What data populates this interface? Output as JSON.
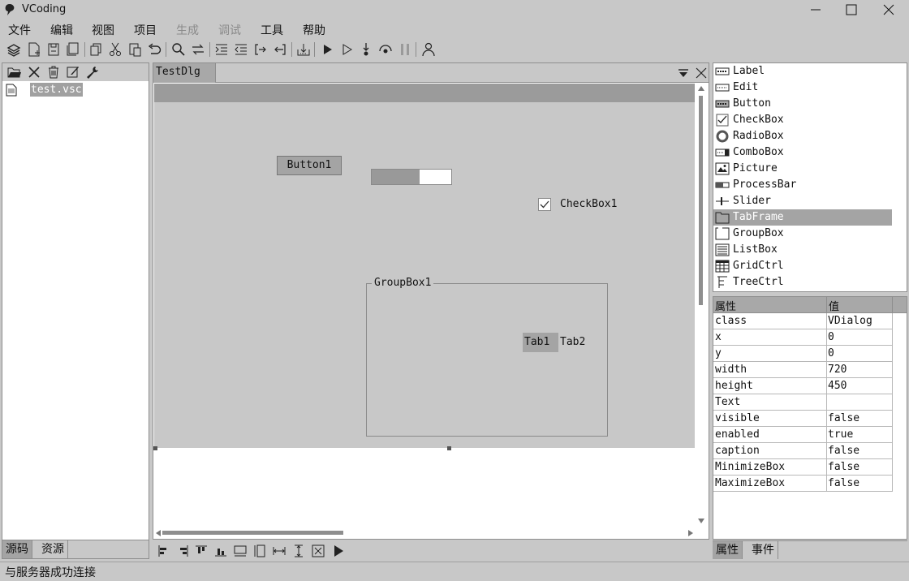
{
  "window": {
    "title": "VCoding",
    "minimize_icon": "minimize-icon",
    "maximize_icon": "maximize-icon",
    "close_icon": "close-icon"
  },
  "menu": [
    "文件",
    "编辑",
    "视图",
    "项目",
    "生成",
    "调试",
    "工具",
    "帮助"
  ],
  "menu_disabled": [
    "生成",
    "调试"
  ],
  "toolbar_icons": [
    "layers-icon",
    "new-file-icon",
    "save-icon",
    "save-all-icon",
    "copy-icon",
    "cut-icon",
    "paste-icon",
    "undo-icon",
    "find-icon",
    "replace-icon",
    "indent-icon",
    "outdent-icon",
    "step-in-icon",
    "step-out-icon",
    "build-icon",
    "run-icon",
    "run-outline-icon",
    "step-icon",
    "watch-icon",
    "pause-icon",
    "user-icon"
  ],
  "left_panel": {
    "toolbar_icons": [
      "open-folder-icon",
      "close-icon",
      "delete-icon",
      "edit-icon",
      "wrench-icon"
    ],
    "files": [
      {
        "name": "test.vsc",
        "icon": "file-icon"
      }
    ],
    "tabs": [
      "源码",
      "资源"
    ],
    "active_tab": "源码"
  },
  "document": {
    "tab_title": "TestDlg",
    "tab_menu_icon": "dropdown-icon",
    "tab_close_icon": "close-icon",
    "controls": {
      "button1": "Button1",
      "progress_value": 0.6,
      "checkbox1": "CheckBox1",
      "checkbox1_checked": true,
      "groupbox1": "GroupBox1",
      "tabs": [
        "Tab1",
        "Tab2"
      ]
    }
  },
  "align_toolbar_icons": [
    "align-left-icon",
    "align-right-icon",
    "align-top-icon",
    "align-bottom-icon",
    "same-width-icon",
    "same-height-icon",
    "center-horizontal-icon",
    "center-vertical-icon",
    "center-icon",
    "preview-run-icon"
  ],
  "toolbox": {
    "items": [
      {
        "label": "Label",
        "icon": "label-control-icon"
      },
      {
        "label": "Edit",
        "icon": "edit-control-icon"
      },
      {
        "label": "Button",
        "icon": "button-control-icon"
      },
      {
        "label": "CheckBox",
        "icon": "checkbox-control-icon"
      },
      {
        "label": "RadioBox",
        "icon": "radiobox-control-icon"
      },
      {
        "label": "ComboBox",
        "icon": "combobox-control-icon"
      },
      {
        "label": "Picture",
        "icon": "picture-control-icon"
      },
      {
        "label": "ProcessBar",
        "icon": "processbar-control-icon"
      },
      {
        "label": "Slider",
        "icon": "slider-control-icon"
      },
      {
        "label": "TabFrame",
        "icon": "tabframe-control-icon"
      },
      {
        "label": "GroupBox",
        "icon": "groupbox-control-icon"
      },
      {
        "label": "ListBox",
        "icon": "listbox-control-icon"
      },
      {
        "label": "GridCtrl",
        "icon": "gridctrl-control-icon"
      },
      {
        "label": "TreeCtrl",
        "icon": "treectrl-control-icon"
      }
    ],
    "selected": "TabFrame"
  },
  "properties": {
    "header_key": "属性",
    "header_value": "值",
    "rows": [
      {
        "key": "class",
        "value": "VDialog"
      },
      {
        "key": "x",
        "value": "0"
      },
      {
        "key": "y",
        "value": "0"
      },
      {
        "key": "width",
        "value": "720"
      },
      {
        "key": "height",
        "value": "450"
      },
      {
        "key": "Text",
        "value": ""
      },
      {
        "key": "visible",
        "value": "false"
      },
      {
        "key": "enabled",
        "value": "true"
      },
      {
        "key": "caption",
        "value": "false"
      },
      {
        "key": "MinimizeBox",
        "value": "false"
      },
      {
        "key": "MaximizeBox",
        "value": "false"
      }
    ],
    "tabs": [
      "属性",
      "事件"
    ],
    "active_tab": "属性"
  },
  "status": "与服务器成功连接",
  "colors": {
    "background": "#c8c8c8",
    "selection": "#a4a4a4",
    "dialog_caption": "#9b9b9b"
  }
}
